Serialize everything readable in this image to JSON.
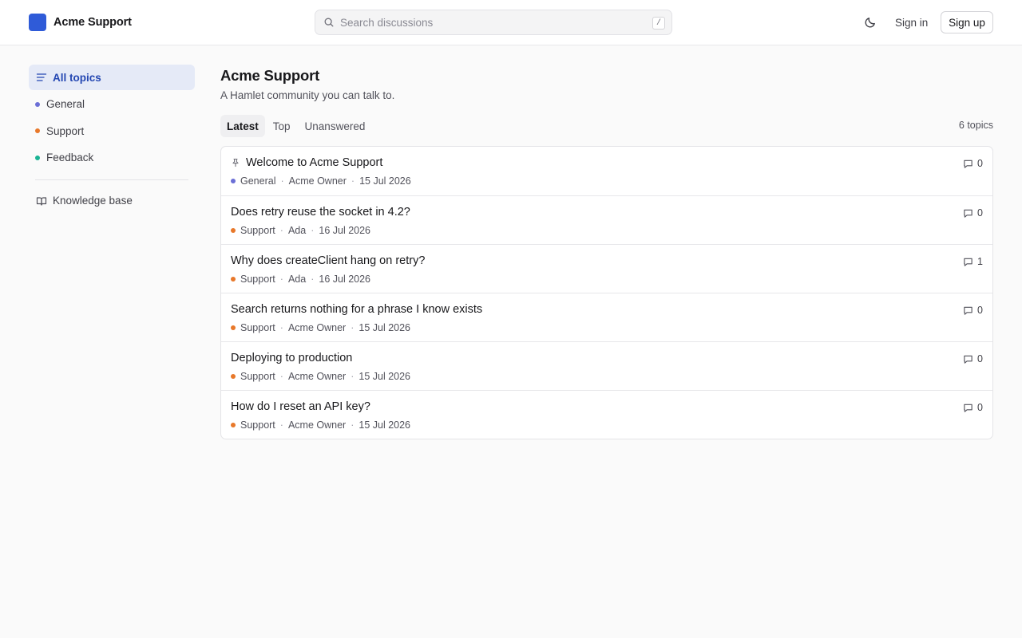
{
  "brand": {
    "name": "Acme Support",
    "color": "#2f5bd8"
  },
  "search": {
    "placeholder": "Search discussions",
    "shortcut": "/"
  },
  "header": {
    "theme_icon": "moon-icon",
    "sign_in": "Sign in",
    "sign_up": "Sign up"
  },
  "sidebar": {
    "all_topics": "All topics",
    "categories": [
      {
        "label": "General",
        "color": "#6b6fd6"
      },
      {
        "label": "Support",
        "color": "#e8782a"
      },
      {
        "label": "Feedback",
        "color": "#1ab394"
      }
    ],
    "knowledge_base": "Knowledge base"
  },
  "main": {
    "title": "Acme Support",
    "subtitle": "A Hamlet community you can talk to.",
    "tabs": [
      "Latest",
      "Top",
      "Unanswered"
    ],
    "active_tab": "Latest",
    "topic_count": "6 topics"
  },
  "topics": [
    {
      "title": "Welcome to Acme Support",
      "pinned": true,
      "category": "General",
      "category_color": "#6b6fd6",
      "author": "Acme Owner",
      "date": "15 Jul 2026",
      "replies": "0"
    },
    {
      "title": "Does retry reuse the socket in 4.2?",
      "pinned": false,
      "category": "Support",
      "category_color": "#e8782a",
      "author": "Ada",
      "date": "16 Jul 2026",
      "replies": "0"
    },
    {
      "title": "Why does createClient hang on retry?",
      "pinned": false,
      "category": "Support",
      "category_color": "#e8782a",
      "author": "Ada",
      "date": "16 Jul 2026",
      "replies": "1"
    },
    {
      "title": "Search returns nothing for a phrase I know exists",
      "pinned": false,
      "category": "Support",
      "category_color": "#e8782a",
      "author": "Acme Owner",
      "date": "15 Jul 2026",
      "replies": "0"
    },
    {
      "title": "Deploying to production",
      "pinned": false,
      "category": "Support",
      "category_color": "#e8782a",
      "author": "Acme Owner",
      "date": "15 Jul 2026",
      "replies": "0"
    },
    {
      "title": "How do I reset an API key?",
      "pinned": false,
      "category": "Support",
      "category_color": "#e8782a",
      "author": "Acme Owner",
      "date": "15 Jul 2026",
      "replies": "0"
    }
  ]
}
